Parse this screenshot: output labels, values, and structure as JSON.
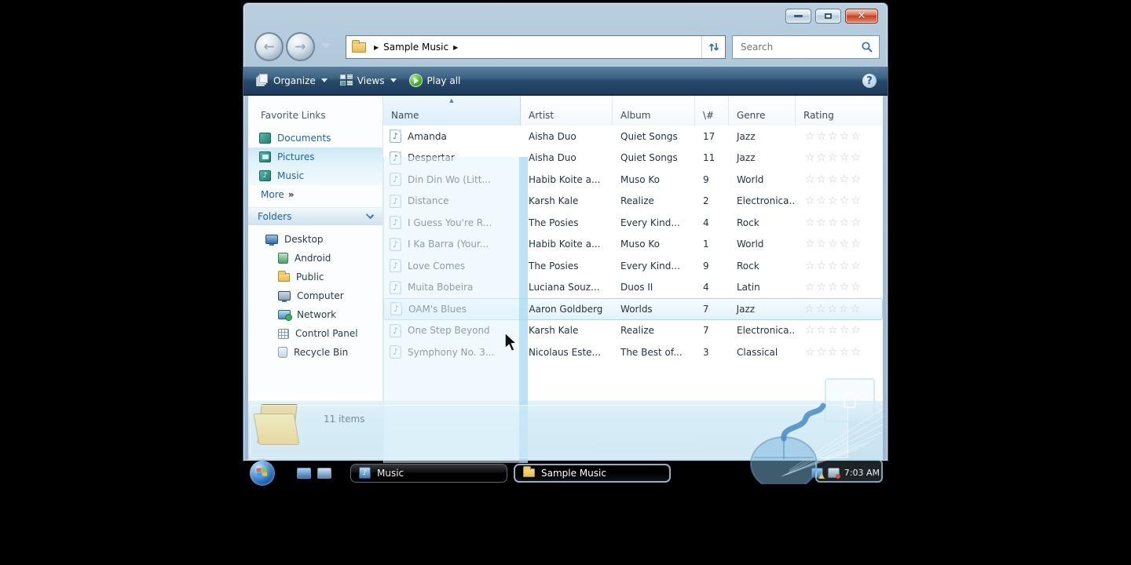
{
  "window": {
    "caption_buttons": [
      "minimize",
      "maximize",
      "close"
    ]
  },
  "navbar": {
    "address_path": "Sample Music",
    "search_placeholder": "Search"
  },
  "toolbar": {
    "organize_label": "Organize",
    "views_label": "Views",
    "play_all_label": "Play all"
  },
  "sidebar": {
    "favorite_links_title": "Favorite Links",
    "links": [
      "Documents",
      "Pictures",
      "Music"
    ],
    "more_label": "More",
    "folders_label": "Folders",
    "tree": [
      "Desktop",
      "Android",
      "Public",
      "Computer",
      "Network",
      "Control Panel",
      "Recycle Bin"
    ]
  },
  "list": {
    "columns": [
      "Name",
      "Artist",
      "Album",
      "\\#",
      "Genre",
      "Rating"
    ],
    "rows": [
      {
        "name": "Amanda",
        "artist": "Aisha Duo",
        "album": "Quiet Songs",
        "num": "17",
        "genre": "Jazz",
        "state": "normal"
      },
      {
        "name": "Despertar",
        "artist": "Aisha Duo",
        "album": "Quiet Songs",
        "num": "11",
        "genre": "Jazz",
        "state": "normal"
      },
      {
        "name": "Din Din Wo (Litt...",
        "artist": "Habib Koite a...",
        "album": "Muso Ko",
        "num": "9",
        "genre": "World",
        "state": "normal"
      },
      {
        "name": "Distance",
        "artist": "Karsh Kale",
        "album": "Realize",
        "num": "2",
        "genre": "Electronica...",
        "state": "normal"
      },
      {
        "name": "I Guess You're R...",
        "artist": "The Posies",
        "album": "Every Kind...",
        "num": "4",
        "genre": "Rock",
        "state": "normal"
      },
      {
        "name": "I Ka Barra (Your...",
        "artist": "Habib Koite a...",
        "album": "Muso Ko",
        "num": "1",
        "genre": "World",
        "state": "normal"
      },
      {
        "name": "Love Comes",
        "artist": "The Posies",
        "album": "Every Kind...",
        "num": "9",
        "genre": "Rock",
        "state": "normal"
      },
      {
        "name": "Muita Bobeira",
        "artist": "Luciana Souz...",
        "album": "Duos II",
        "num": "4",
        "genre": "Latin",
        "state": "normal"
      },
      {
        "name": "OAM's Blues",
        "artist": "Aaron Goldberg",
        "album": "Worlds",
        "num": "7",
        "genre": "Jazz",
        "state": "hover"
      },
      {
        "name": "One Step Beyond",
        "artist": "Karsh Kale",
        "album": "Realize",
        "num": "7",
        "genre": "Electronica...",
        "state": "normal"
      },
      {
        "name": "Symphony No. 3...",
        "artist": "Nicolaus Este...",
        "album": "The Best of...",
        "num": "3",
        "genre": "Classical",
        "state": "normal"
      }
    ]
  },
  "details": {
    "items_count": "11 items"
  },
  "taskbar": {
    "buttons": [
      {
        "label": "Music",
        "active": false
      },
      {
        "label": "Sample Music",
        "active": true
      }
    ],
    "clock": "7:03 AM"
  },
  "icons": {
    "back_arrow": "←",
    "forward_arrow": "→",
    "breadcrumb_arrow": "▶",
    "refresh": "⇅",
    "search_magnifier": "search-magnifier",
    "help": "?",
    "sort_asc": "▲",
    "more_double_chevron": "»",
    "music_note": "♪",
    "rating_stars": "☆☆☆☆☆",
    "close_x": "✕"
  },
  "colors": {
    "toolbar_blue": "#28496a",
    "header_highlight": "#ddeffa",
    "row_hover_border": "#aad6ef",
    "link_blue": "#1a64a8",
    "close_red": "#c43a22",
    "details_pane": "#cfe7f3"
  }
}
